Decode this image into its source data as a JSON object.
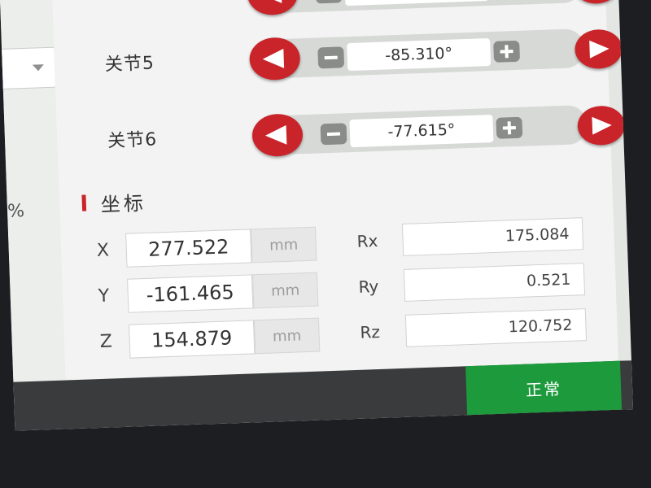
{
  "left_panel": {
    "percent_symbol": "%"
  },
  "joints": [
    {
      "label": "",
      "value": ""
    },
    {
      "label": "关节5",
      "value": "-85.310°"
    },
    {
      "label": "关节6",
      "value": "-77.615°"
    }
  ],
  "coordinates": {
    "title": "坐标",
    "rows": [
      {
        "axis": "X",
        "value": "277.522",
        "unit": "mm",
        "rot_axis": "Rx",
        "rot_value": "175.084"
      },
      {
        "axis": "Y",
        "value": "-161.465",
        "unit": "mm",
        "rot_axis": "Ry",
        "rot_value": "0.521"
      },
      {
        "axis": "Z",
        "value": "154.879",
        "unit": "mm",
        "rot_axis": "Rz",
        "rot_value": "120.752"
      }
    ]
  },
  "status": {
    "label": "正常",
    "color": "#1d9a3c"
  },
  "colors": {
    "accent_red": "#c9242a",
    "panel_bg": "#f2f3f2",
    "stepper_gray": "#8a8c8a"
  }
}
